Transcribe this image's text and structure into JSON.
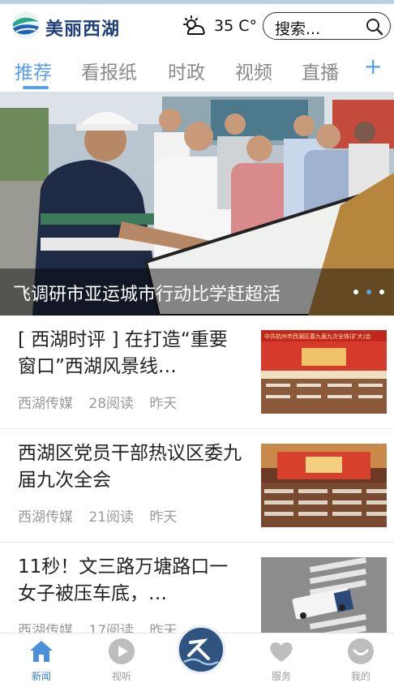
{
  "header": {
    "brand": "美丽西湖",
    "temperature": "35 C°",
    "search_label": "搜索...",
    "brand_color": "#1d3f7a",
    "accent_color": "#5aa0e6"
  },
  "tabs": {
    "items": [
      "推荐",
      "看报纸",
      "时政",
      "视频",
      "直播"
    ],
    "active": "推荐",
    "add_label": "+"
  },
  "banner": {
    "title": "飞调研市亚运城市行动比学赶超活",
    "slide_count": 3,
    "active_slide": 2
  },
  "news": [
    {
      "title": "[ 西湖时评 ] 在打造“重要窗口”西湖风景线…",
      "source": "西湖传媒",
      "reads": "28阅读",
      "time": "昨天",
      "thumb_caption": "中共杭州市西湖区委九届九次全体(扩大)会"
    },
    {
      "title": "西湖区党员干部热议区委九届九次全会",
      "source": "西湖传媒",
      "reads": "21阅读",
      "time": "昨天"
    },
    {
      "title": "11秒！文三路万塘路口一女子被压车底，…",
      "source": "西湖传媒",
      "reads": "17阅读",
      "time": "昨天"
    }
  ],
  "bottom_nav": {
    "items": [
      {
        "label": "新闻",
        "icon": "home-icon",
        "active": true
      },
      {
        "label": "视听",
        "icon": "play-icon",
        "active": false
      },
      {
        "label": "",
        "icon": "center-logo-icon",
        "active": false
      },
      {
        "label": "服务",
        "icon": "heart-icon",
        "active": false
      },
      {
        "label": "我的",
        "icon": "profile-icon",
        "active": false
      }
    ]
  }
}
